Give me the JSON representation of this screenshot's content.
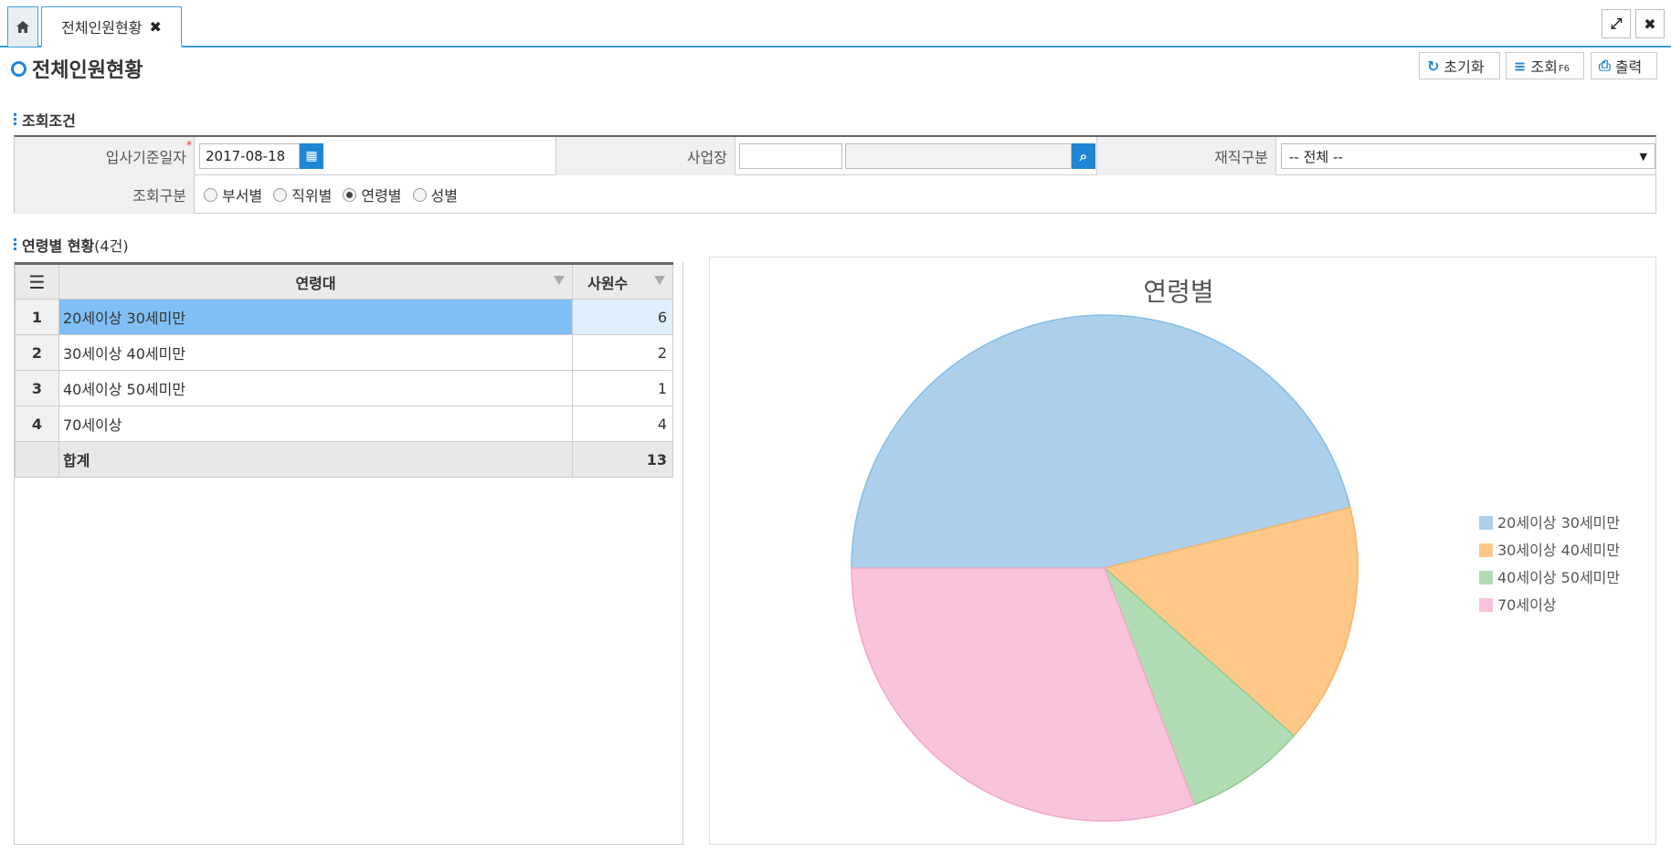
{
  "tabs": {
    "home_icon": "home-icon",
    "active_tab": "전체인원현황",
    "close_glyph": "✖"
  },
  "window": {
    "expand_icon": "expand-icon",
    "close_icon": "close-icon"
  },
  "page": {
    "title": "전체인원현황"
  },
  "toolbar": {
    "reset": "초기화",
    "search": "조회",
    "search_key": "F6",
    "print": "출력"
  },
  "conditions": {
    "section_title": "조회조건",
    "hire_date_label": "입사기준일자",
    "hire_date_value": "2017-08-18",
    "site_label": "사업장",
    "site_code": "",
    "site_name": "",
    "employment_label": "재직구분",
    "employment_value": "-- 전체 --",
    "query_type_label": "조회구분",
    "query_options": [
      "부서별",
      "직위별",
      "연령별",
      "성별"
    ],
    "query_selected": "연령별"
  },
  "grid": {
    "section_title": "연령별 현황",
    "count_text": "(4건)",
    "columns": [
      "연령대",
      "사원수"
    ],
    "rows": [
      {
        "no": "1",
        "label": "20세이상 30세미만",
        "count": "6"
      },
      {
        "no": "2",
        "label": "30세이상 40세미만",
        "count": "2"
      },
      {
        "no": "3",
        "label": "40세이상 50세미만",
        "count": "1"
      },
      {
        "no": "4",
        "label": "70세이상",
        "count": "4"
      }
    ],
    "total_label": "합계",
    "total_value": "13"
  },
  "chart_data": {
    "type": "pie",
    "title": "연령별",
    "categories": [
      "20세이상 30세미만",
      "30세이상 40세미만",
      "40세이상 50세미만",
      "70세이상"
    ],
    "values": [
      6,
      2,
      1,
      4
    ],
    "colors": [
      "#acd0ec",
      "#fdc888",
      "#b2ddb4",
      "#f8c3db"
    ],
    "stroke_colors": [
      "#85bde6",
      "#f6b26b",
      "#8fca92",
      "#f0a8c8"
    ],
    "legend_position": "right"
  }
}
